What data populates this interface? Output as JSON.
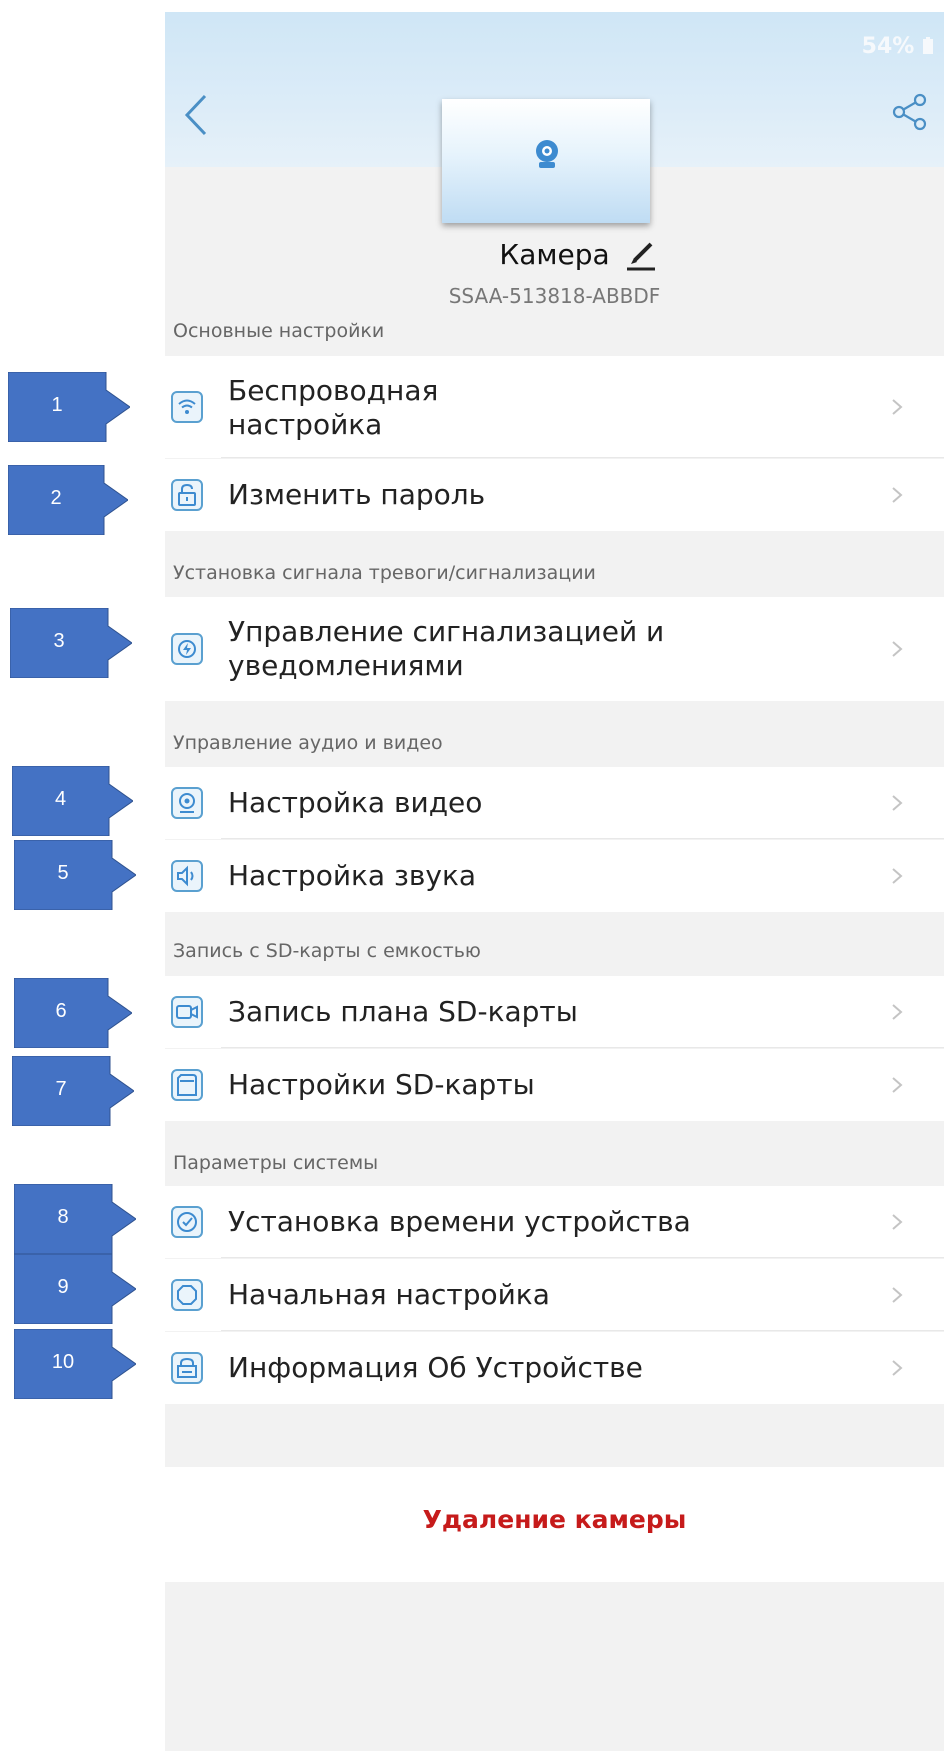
{
  "status": {
    "battery": "54%"
  },
  "device": {
    "name": "Камера",
    "id": "SSAA-513818-ABBDF"
  },
  "sections": {
    "basic": "Основные настройки",
    "alarm": "Установка сигнала тревоги/сигнализации",
    "av": "Управление аудио и видео",
    "sd": "Запись с SD-карты с емкостью",
    "system": "Параметры системы"
  },
  "items": {
    "wifi": {
      "line1": "Беспроводная",
      "line2": "настройка",
      "icon": "wifi-icon"
    },
    "password": {
      "label": "Изменить пароль",
      "icon": "lock-icon"
    },
    "alarm": {
      "line1": "Управление сигнализацией и",
      "line2": "уведомлениями",
      "icon": "alarm-icon"
    },
    "video": {
      "label": "Настройка видео",
      "icon": "video-camera-icon"
    },
    "audio": {
      "label": "Настройка звука",
      "icon": "speaker-icon"
    },
    "sdrecord": {
      "label": "Запись плана SD-карты",
      "icon": "record-icon"
    },
    "sdsettings": {
      "label": "Настройки SD-карты",
      "icon": "sd-card-icon"
    },
    "time": {
      "label": "Установка времени устройства",
      "icon": "clock-icon"
    },
    "reset": {
      "label": "Начальная настройка",
      "icon": "reset-icon"
    },
    "info": {
      "label": "Информация Об Устройстве",
      "icon": "info-icon"
    }
  },
  "delete_label": "Удаление камеры",
  "callouts": [
    "1",
    "2",
    "3",
    "4",
    "5",
    "6",
    "7",
    "8",
    "9",
    "10"
  ],
  "colors": {
    "accent": "#4a90c8",
    "callout": "#4472c4",
    "danger": "#c61b1b"
  }
}
